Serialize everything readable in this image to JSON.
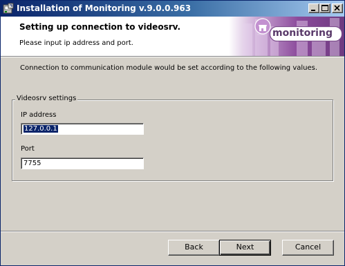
{
  "window": {
    "title": "Installation of Monitoring v.9.0.0.963",
    "icons": {
      "app": "installer-icon",
      "minimize": "minimize-icon",
      "maximize": "maximize-icon",
      "close": "close-icon"
    }
  },
  "header": {
    "title": "Setting up connection to videosrv.",
    "subtitle": "Please input ip address and port.",
    "logo_text": "monitoring"
  },
  "body": {
    "intro": "Connection to communication module would be set according to the following values.",
    "group_label": "Videosrv settings",
    "ip_label": "IP address",
    "ip_value": "127.0.0.1",
    "port_label": "Port",
    "port_value": "7755"
  },
  "buttons": {
    "back": "Back",
    "next": "Next",
    "cancel": "Cancel"
  },
  "colors": {
    "titlebar_start": "#0a246a",
    "titlebar_end": "#a6caf0",
    "banner_purple": "#8b4a9b",
    "window_bg": "#d4d0c8"
  }
}
